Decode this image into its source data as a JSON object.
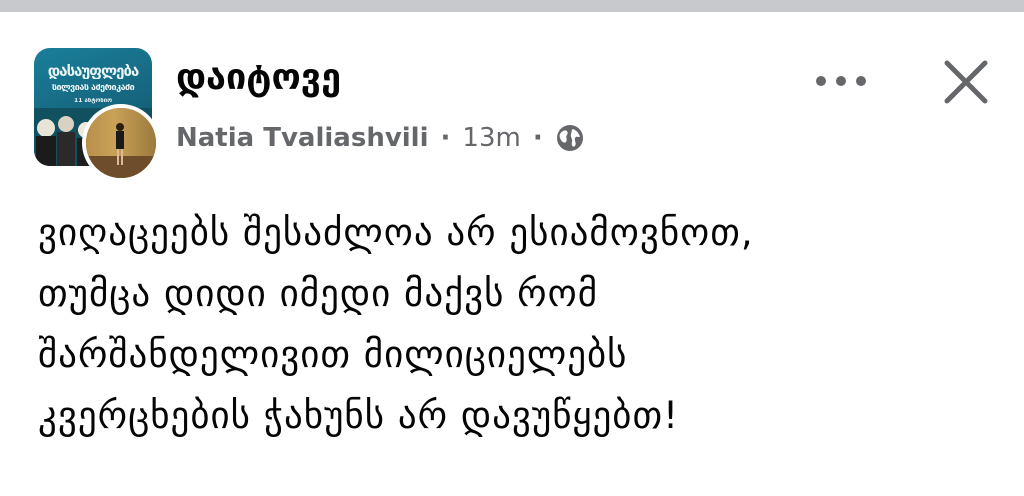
{
  "post": {
    "title": "დაიტოვე",
    "author": "Natia Tvaliashvili",
    "separator_1": "·",
    "time": "13m",
    "separator_2": "·",
    "privacy_icon": "globe-icon",
    "group_avatar_text": {
      "line1": "დასაუფლება",
      "line2": "სილვიას ამერიკაში",
      "line3": "11 ანტონიო"
    },
    "body_lines": [
      "ვიღაცეებს შესაძლოა არ ესიამოვნოთ,",
      "თუმცა დიდი იმედი მაქვს რომ",
      "შარშანდელივით მილიციელებს",
      "კვერცხების ჭახუნს არ დავუწყებთ!"
    ]
  },
  "actions": {
    "more_icon": "more-horizontal-icon",
    "close_icon": "close-icon"
  },
  "colors": {
    "text_primary": "#050505",
    "text_secondary": "#65676b",
    "divider": "#c8c9cc",
    "group_avatar": "#1a7f9a"
  }
}
